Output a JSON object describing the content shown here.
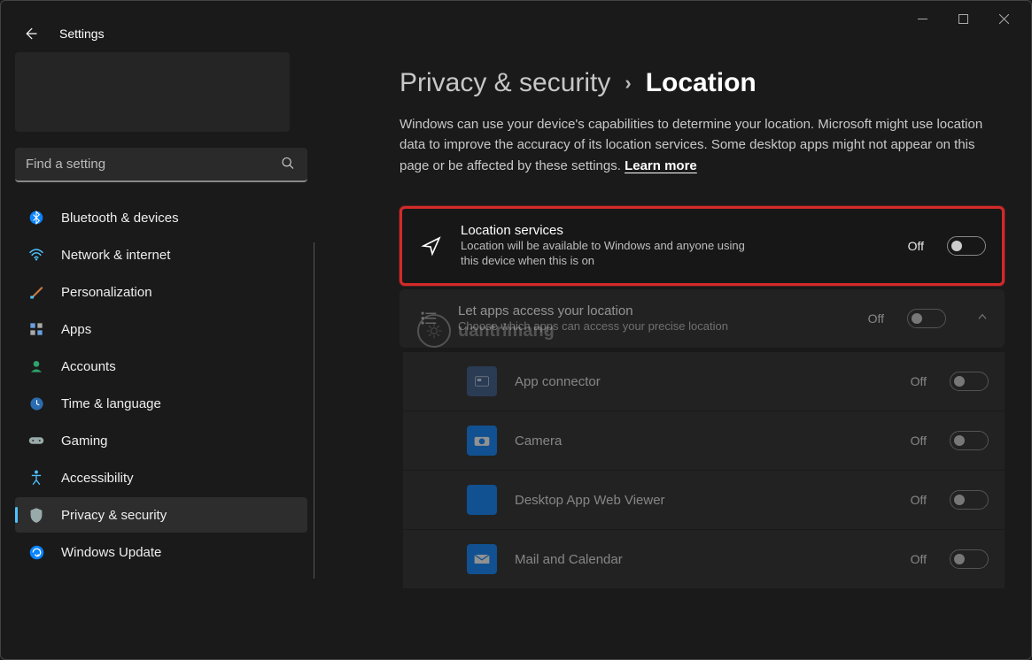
{
  "window": {
    "title": "Settings"
  },
  "search": {
    "placeholder": "Find a setting"
  },
  "sidebar": {
    "items": [
      {
        "label": "Bluetooth & devices"
      },
      {
        "label": "Network & internet"
      },
      {
        "label": "Personalization"
      },
      {
        "label": "Apps"
      },
      {
        "label": "Accounts"
      },
      {
        "label": "Time & language"
      },
      {
        "label": "Gaming"
      },
      {
        "label": "Accessibility"
      },
      {
        "label": "Privacy & security"
      },
      {
        "label": "Windows Update"
      }
    ]
  },
  "breadcrumb": {
    "parent": "Privacy & security",
    "current": "Location"
  },
  "description": {
    "text": "Windows can use your device's capabilities to determine your location. Microsoft might use location data to improve the accuracy of its location services. Some desktop apps might not appear on this page or be affected by these settings.  ",
    "learn_more": "Learn more"
  },
  "cards": {
    "location_services": {
      "title": "Location services",
      "subtitle": "Location will be available to Windows and anyone using this device when this is on",
      "state": "Off"
    },
    "apps_access": {
      "title": "Let apps access your location",
      "subtitle": "Choose which apps can access your precise location",
      "state": "Off"
    }
  },
  "apps": [
    {
      "name": "App connector",
      "state": "Off",
      "icon": "app-connector"
    },
    {
      "name": "Camera",
      "state": "Off",
      "icon": "camera"
    },
    {
      "name": "Desktop App Web Viewer",
      "state": "Off",
      "icon": "web-viewer"
    },
    {
      "name": "Mail and Calendar",
      "state": "Off",
      "icon": "mail"
    }
  ],
  "watermark": "uantrimang"
}
